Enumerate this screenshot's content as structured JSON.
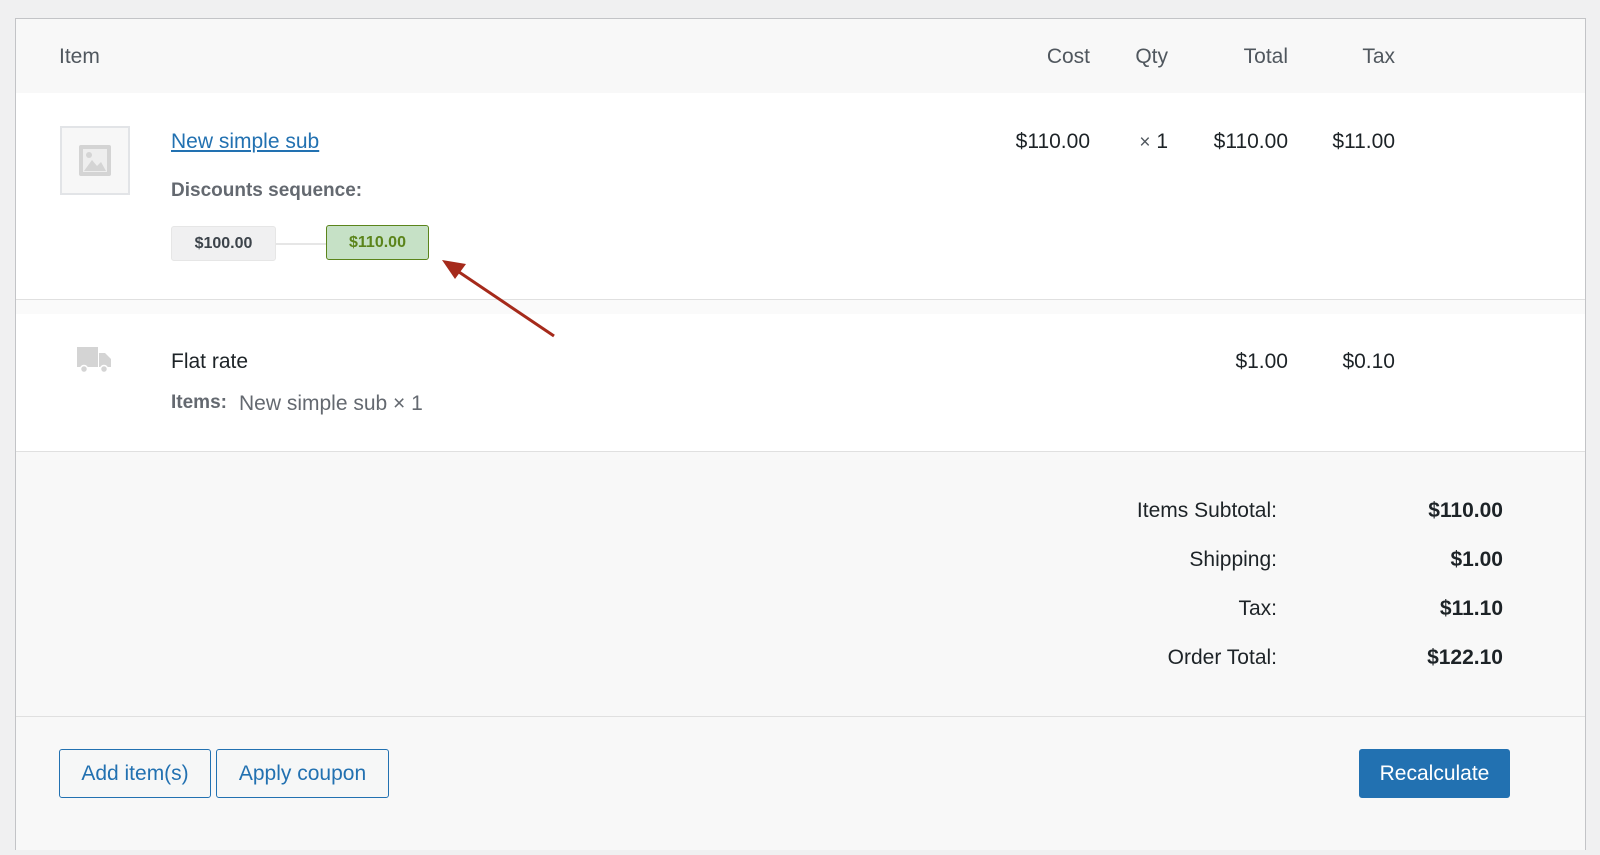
{
  "table": {
    "headers": {
      "item": "Item",
      "cost": "Cost",
      "qty": "Qty",
      "total": "Total",
      "tax": "Tax"
    }
  },
  "line_item": {
    "name": "New simple sub",
    "cost": "$110.00",
    "qty_symbol": "×",
    "qty": "1",
    "total": "$110.00",
    "tax": "$11.00",
    "discounts_label": "Discounts sequence:",
    "sequence": [
      "$100.00",
      "$110.00"
    ],
    "thumbnail_icon": "image-placeholder-icon"
  },
  "shipping": {
    "icon": "truck-icon",
    "method": "Flat rate",
    "items_label": "Items:",
    "items_value": "New simple sub × 1",
    "total": "$1.00",
    "tax": "$0.10"
  },
  "totals": [
    {
      "label": "Items Subtotal:",
      "value": "$110.00"
    },
    {
      "label": "Shipping:",
      "value": "$1.00"
    },
    {
      "label": "Tax:",
      "value": "$11.10"
    },
    {
      "label": "Order Total:",
      "value": "$122.10"
    }
  ],
  "actions": {
    "add_items": "Add item(s)",
    "apply_coupon": "Apply coupon",
    "recalculate": "Recalculate"
  },
  "colors": {
    "link": "#2271b1",
    "chip_highlight_bg": "#c6e1c6",
    "chip_highlight_text": "#5b841b",
    "annotation_arrow": "#a52a1b"
  }
}
